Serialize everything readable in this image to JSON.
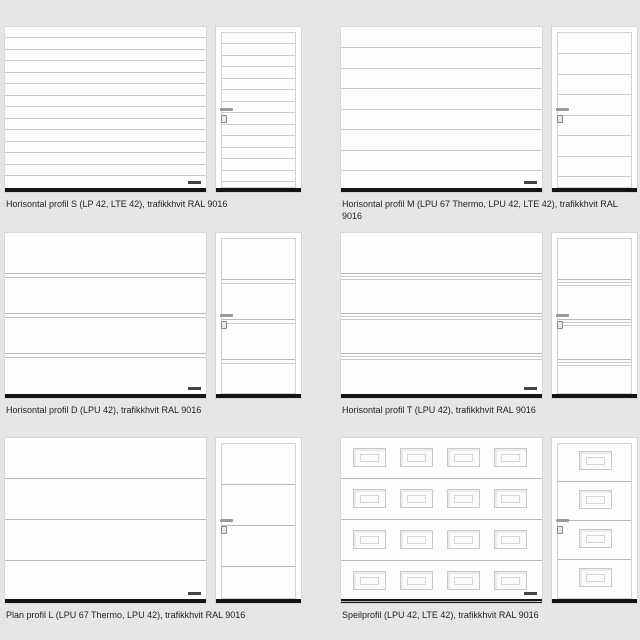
{
  "products": [
    {
      "id": "profil-s",
      "caption": "Horisontal profil S (LP 42, LTE 42), trafikkhvit RAL 9016",
      "pattern": "ribbed-small",
      "color_ral": "RAL 9016"
    },
    {
      "id": "profil-m",
      "caption": "Horisontal profil M (LPU 67 Thermo, LPU 42, LTE 42), trafikkhvit RAL 9016",
      "pattern": "ribbed-medium",
      "color_ral": "RAL 9016"
    },
    {
      "id": "profil-d",
      "caption": "Horisontal profil D (LPU 42), trafikkhvit RAL 9016",
      "pattern": "double-groove",
      "color_ral": "RAL 9016"
    },
    {
      "id": "profil-t",
      "caption": "Horisontal profil T (LPU 42), trafikkhvit RAL 9016",
      "pattern": "triple-groove",
      "color_ral": "RAL 9016"
    },
    {
      "id": "plan-l",
      "caption": "Plan profil L (LPU 67 Thermo, LPU 42), trafikkhvit RAL 9016",
      "pattern": "flat-sections",
      "color_ral": "RAL 9016"
    },
    {
      "id": "speil",
      "caption": "Speilprofil (LPU 42, LTE 42), trafikkhvit RAL 9016",
      "pattern": "raised-panels",
      "color_ral": "RAL 9016"
    }
  ],
  "colors": {
    "background": "#e4e6e8",
    "door": "#fdfdfd",
    "base": "#151515"
  }
}
